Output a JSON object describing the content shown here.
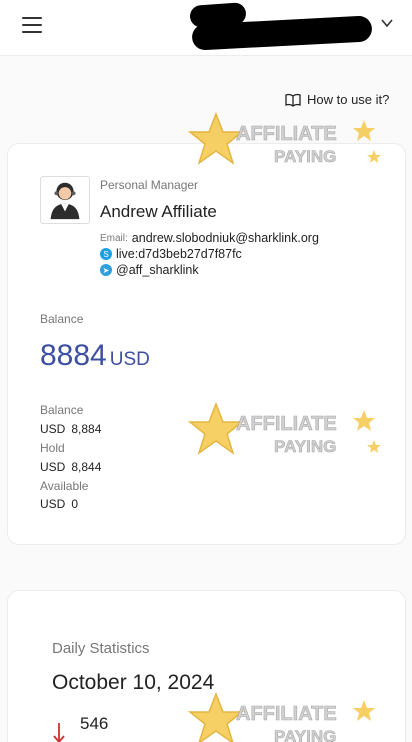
{
  "header": {
    "menu_icon": "hamburger-icon",
    "account_chevron": "chevron-down-icon"
  },
  "help": {
    "label": "How to use it?",
    "icon": "book-icon"
  },
  "manager": {
    "section_label": "Personal Manager",
    "name": "Andrew Affiliate",
    "email_label": "Email:",
    "email": "andrew.slobodniuk@sharklink.org",
    "skype": "live:d7d3beb27d7f87fc",
    "telegram": "@aff_sharklink"
  },
  "balance": {
    "label": "Balance",
    "amount": "8884",
    "currency": "USD",
    "rows": [
      {
        "label": "Balance",
        "currency": "USD",
        "value": "8,884"
      },
      {
        "label": "Hold",
        "currency": "USD",
        "value": "8,844"
      },
      {
        "label": "Available",
        "currency": "USD",
        "value": "0"
      }
    ]
  },
  "daily": {
    "label": "Daily Statistics",
    "date": "October 10, 2024",
    "value": "546"
  },
  "watermark": {
    "line1": "AFFILIATE",
    "line2": "PAYING"
  },
  "colors": {
    "accent": "#3d4fa3",
    "down": "#d0312d"
  }
}
